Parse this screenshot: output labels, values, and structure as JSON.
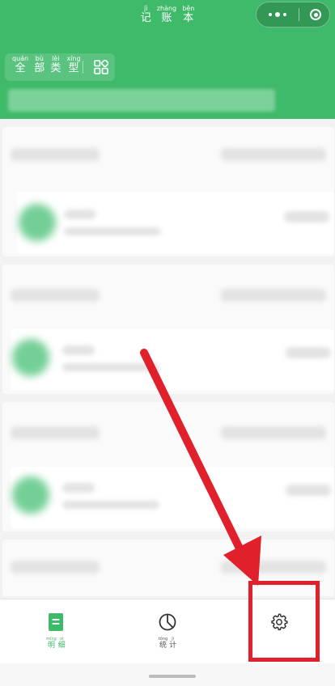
{
  "header": {
    "title": [
      {
        "py": "jì",
        "hz": "记"
      },
      {
        "py": "zhàng",
        "hz": "账"
      },
      {
        "py": "běn",
        "hz": "本"
      }
    ],
    "type_filter": [
      {
        "py": "quán",
        "hz": "全"
      },
      {
        "py": "bù",
        "hz": "部"
      },
      {
        "py": "lèi",
        "hz": "类"
      },
      {
        "py": "xíng",
        "hz": "型"
      }
    ]
  },
  "tabs": [
    {
      "name": "tab-details",
      "chars": [
        {
          "py": "míng",
          "hz": "明"
        },
        {
          "py": "xì",
          "hz": "细"
        }
      ],
      "icon": "document-icon",
      "active": true
    },
    {
      "name": "tab-stats",
      "chars": [
        {
          "py": "tǒng",
          "hz": "统"
        },
        {
          "py": "jì",
          "hz": "计"
        }
      ],
      "icon": "pie-chart-icon",
      "active": false
    },
    {
      "name": "tab-settings",
      "chars": [],
      "icon": "gear-icon",
      "active": false
    }
  ],
  "colors": {
    "brand": "#3fba6a",
    "annotation": "#e0202a"
  }
}
